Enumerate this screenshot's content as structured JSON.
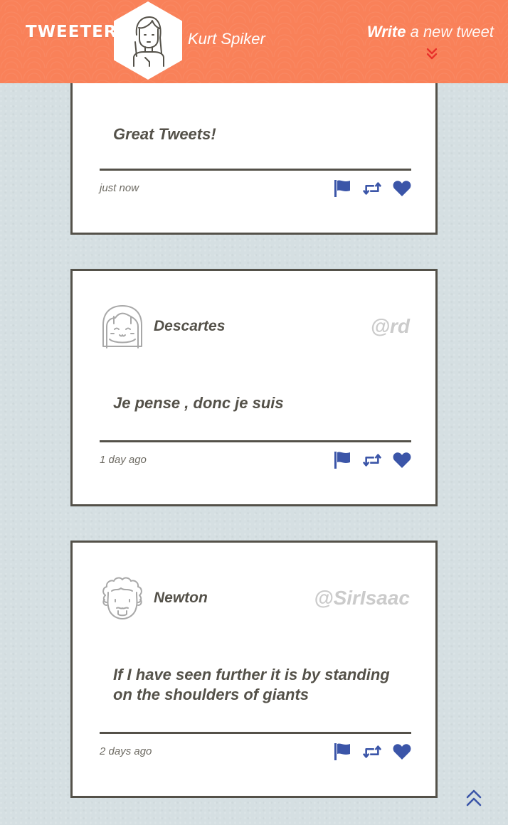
{
  "header": {
    "brand": "TWEETER",
    "user_name": "Kurt Spiker",
    "compose_bold": "Write",
    "compose_rest": " a new tweet"
  },
  "colors": {
    "header_bg": "#f98159",
    "page_bg": "#d5dfe2",
    "card_border": "#545149",
    "action_icon": "#3b55a8",
    "compose_arrow": "#e8312b"
  },
  "tweets": [
    {
      "author": "",
      "handle": "",
      "text": "Great Tweets!",
      "time": "just now",
      "avatar_icon": "user-avatar-icon"
    },
    {
      "author": "Descartes",
      "handle": "@rd",
      "text": "Je pense , donc je suis",
      "time": "1 day ago",
      "avatar_icon": "girl-avatar-icon"
    },
    {
      "author": "Newton",
      "handle": "@SirIsaac",
      "text": "If I have seen further it is by standing on the shoulders of giants",
      "time": "2 days ago",
      "avatar_icon": "curly-hair-avatar-icon"
    }
  ],
  "icons": {
    "flag": "flag-icon",
    "retweet": "retweet-icon",
    "like": "heart-icon",
    "compose": "double-chevron-down-icon",
    "scroll_top": "double-chevron-up-icon"
  }
}
